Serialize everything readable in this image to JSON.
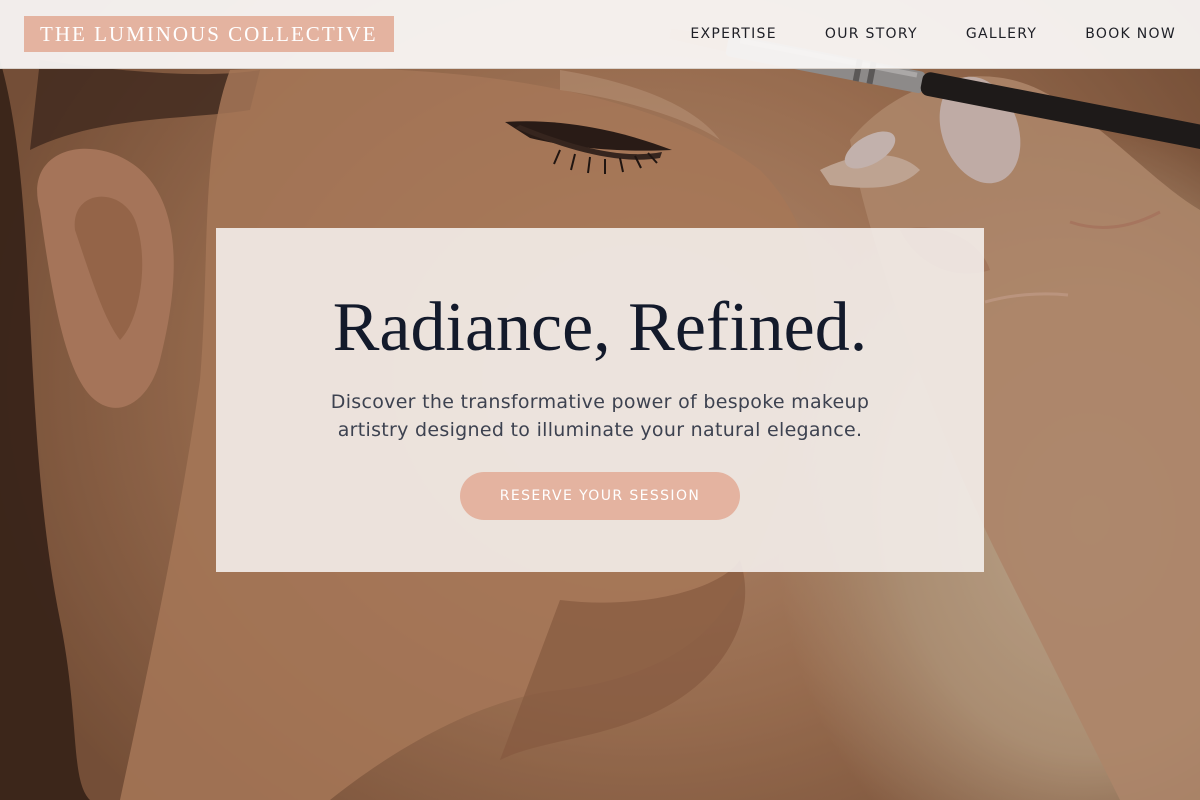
{
  "header": {
    "logo_text": "THE LUMINOUS COLLECTIVE",
    "nav": [
      {
        "label": "EXPERTISE"
      },
      {
        "label": "OUR STORY"
      },
      {
        "label": "GALLERY"
      },
      {
        "label": "BOOK NOW"
      }
    ]
  },
  "hero": {
    "background_image": "woman-applying-eye-makeup-photo",
    "title": "Radiance, Refined.",
    "subtitle": "Discover the transformative power of bespoke makeup artistry designed to illuminate your natural elegance.",
    "cta_label": "RESERVE YOUR SESSION"
  },
  "colors": {
    "accent": "#e4b3a0",
    "heading": "#131a2b",
    "body_text": "#3d4250",
    "header_bg": "#faf8f6"
  }
}
